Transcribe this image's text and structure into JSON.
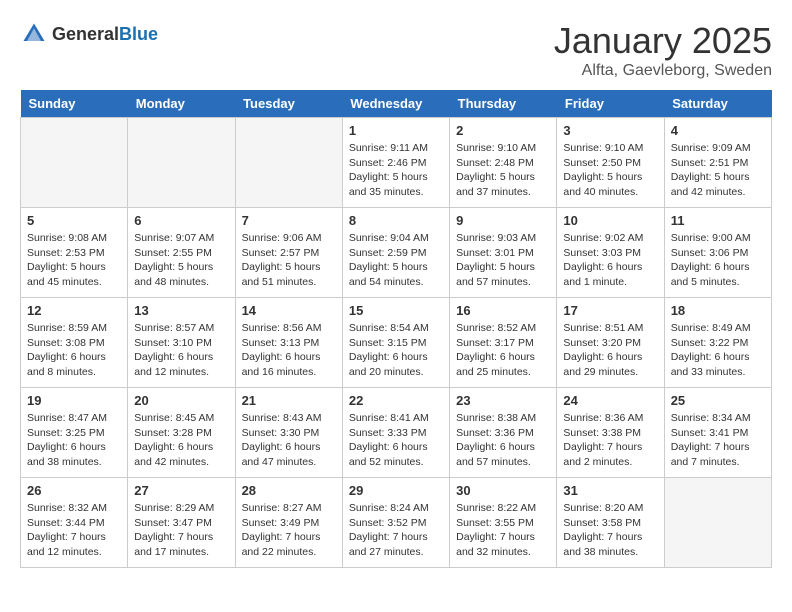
{
  "header": {
    "logo_general": "General",
    "logo_blue": "Blue",
    "month_title": "January 2025",
    "location": "Alfta, Gaevleborg, Sweden"
  },
  "days_of_week": [
    "Sunday",
    "Monday",
    "Tuesday",
    "Wednesday",
    "Thursday",
    "Friday",
    "Saturday"
  ],
  "weeks": [
    [
      {
        "day": "",
        "info": ""
      },
      {
        "day": "",
        "info": ""
      },
      {
        "day": "",
        "info": ""
      },
      {
        "day": "1",
        "info": "Sunrise: 9:11 AM\nSunset: 2:46 PM\nDaylight: 5 hours\nand 35 minutes."
      },
      {
        "day": "2",
        "info": "Sunrise: 9:10 AM\nSunset: 2:48 PM\nDaylight: 5 hours\nand 37 minutes."
      },
      {
        "day": "3",
        "info": "Sunrise: 9:10 AM\nSunset: 2:50 PM\nDaylight: 5 hours\nand 40 minutes."
      },
      {
        "day": "4",
        "info": "Sunrise: 9:09 AM\nSunset: 2:51 PM\nDaylight: 5 hours\nand 42 minutes."
      }
    ],
    [
      {
        "day": "5",
        "info": "Sunrise: 9:08 AM\nSunset: 2:53 PM\nDaylight: 5 hours\nand 45 minutes."
      },
      {
        "day": "6",
        "info": "Sunrise: 9:07 AM\nSunset: 2:55 PM\nDaylight: 5 hours\nand 48 minutes."
      },
      {
        "day": "7",
        "info": "Sunrise: 9:06 AM\nSunset: 2:57 PM\nDaylight: 5 hours\nand 51 minutes."
      },
      {
        "day": "8",
        "info": "Sunrise: 9:04 AM\nSunset: 2:59 PM\nDaylight: 5 hours\nand 54 minutes."
      },
      {
        "day": "9",
        "info": "Sunrise: 9:03 AM\nSunset: 3:01 PM\nDaylight: 5 hours\nand 57 minutes."
      },
      {
        "day": "10",
        "info": "Sunrise: 9:02 AM\nSunset: 3:03 PM\nDaylight: 6 hours\nand 1 minute."
      },
      {
        "day": "11",
        "info": "Sunrise: 9:00 AM\nSunset: 3:06 PM\nDaylight: 6 hours\nand 5 minutes."
      }
    ],
    [
      {
        "day": "12",
        "info": "Sunrise: 8:59 AM\nSunset: 3:08 PM\nDaylight: 6 hours\nand 8 minutes."
      },
      {
        "day": "13",
        "info": "Sunrise: 8:57 AM\nSunset: 3:10 PM\nDaylight: 6 hours\nand 12 minutes."
      },
      {
        "day": "14",
        "info": "Sunrise: 8:56 AM\nSunset: 3:13 PM\nDaylight: 6 hours\nand 16 minutes."
      },
      {
        "day": "15",
        "info": "Sunrise: 8:54 AM\nSunset: 3:15 PM\nDaylight: 6 hours\nand 20 minutes."
      },
      {
        "day": "16",
        "info": "Sunrise: 8:52 AM\nSunset: 3:17 PM\nDaylight: 6 hours\nand 25 minutes."
      },
      {
        "day": "17",
        "info": "Sunrise: 8:51 AM\nSunset: 3:20 PM\nDaylight: 6 hours\nand 29 minutes."
      },
      {
        "day": "18",
        "info": "Sunrise: 8:49 AM\nSunset: 3:22 PM\nDaylight: 6 hours\nand 33 minutes."
      }
    ],
    [
      {
        "day": "19",
        "info": "Sunrise: 8:47 AM\nSunset: 3:25 PM\nDaylight: 6 hours\nand 38 minutes."
      },
      {
        "day": "20",
        "info": "Sunrise: 8:45 AM\nSunset: 3:28 PM\nDaylight: 6 hours\nand 42 minutes."
      },
      {
        "day": "21",
        "info": "Sunrise: 8:43 AM\nSunset: 3:30 PM\nDaylight: 6 hours\nand 47 minutes."
      },
      {
        "day": "22",
        "info": "Sunrise: 8:41 AM\nSunset: 3:33 PM\nDaylight: 6 hours\nand 52 minutes."
      },
      {
        "day": "23",
        "info": "Sunrise: 8:38 AM\nSunset: 3:36 PM\nDaylight: 6 hours\nand 57 minutes."
      },
      {
        "day": "24",
        "info": "Sunrise: 8:36 AM\nSunset: 3:38 PM\nDaylight: 7 hours\nand 2 minutes."
      },
      {
        "day": "25",
        "info": "Sunrise: 8:34 AM\nSunset: 3:41 PM\nDaylight: 7 hours\nand 7 minutes."
      }
    ],
    [
      {
        "day": "26",
        "info": "Sunrise: 8:32 AM\nSunset: 3:44 PM\nDaylight: 7 hours\nand 12 minutes."
      },
      {
        "day": "27",
        "info": "Sunrise: 8:29 AM\nSunset: 3:47 PM\nDaylight: 7 hours\nand 17 minutes."
      },
      {
        "day": "28",
        "info": "Sunrise: 8:27 AM\nSunset: 3:49 PM\nDaylight: 7 hours\nand 22 minutes."
      },
      {
        "day": "29",
        "info": "Sunrise: 8:24 AM\nSunset: 3:52 PM\nDaylight: 7 hours\nand 27 minutes."
      },
      {
        "day": "30",
        "info": "Sunrise: 8:22 AM\nSunset: 3:55 PM\nDaylight: 7 hours\nand 32 minutes."
      },
      {
        "day": "31",
        "info": "Sunrise: 8:20 AM\nSunset: 3:58 PM\nDaylight: 7 hours\nand 38 minutes."
      },
      {
        "day": "",
        "info": ""
      }
    ]
  ]
}
